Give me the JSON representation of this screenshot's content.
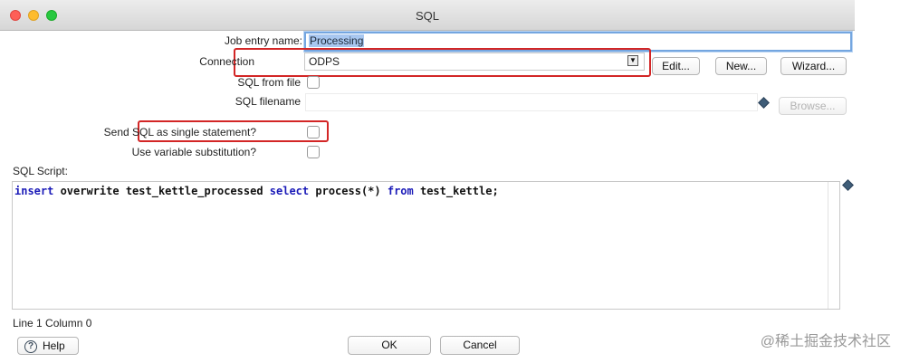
{
  "window": {
    "title": "SQL"
  },
  "form": {
    "job_entry_name_label": "Job entry name:",
    "job_entry_name_value": "Processing",
    "connection_label": "Connection",
    "connection_value": "ODPS",
    "sql_from_file_label": "SQL from file",
    "sql_filename_label": "SQL filename",
    "sql_filename_value": "",
    "send_single_label": "Send SQL as single statement?",
    "use_variable_label": "Use variable substitution?",
    "sql_script_label": "SQL Script:"
  },
  "buttons": {
    "edit": "Edit...",
    "new": "New...",
    "wizard": "Wizard...",
    "browse": "Browse...",
    "help": "Help",
    "ok": "OK",
    "cancel": "Cancel"
  },
  "editor": {
    "tokens": [
      {
        "t": "insert",
        "kw": true
      },
      {
        "t": " overwrite test_kettle_processed ",
        "kw": false
      },
      {
        "t": "select",
        "kw": true
      },
      {
        "t": " process(*) ",
        "kw": false
      },
      {
        "t": "from",
        "kw": true
      },
      {
        "t": " test_kettle;",
        "kw": false
      }
    ]
  },
  "status": {
    "line_col": "Line 1 Column 0"
  },
  "checkboxes": {
    "sql_from_file": false,
    "send_single": false,
    "use_variable": false
  },
  "watermark": "@稀土掘金技术社区",
  "colors": {
    "highlight_box": "#d32626",
    "keyword": "#1b1bb8",
    "focus": "#74a6e0"
  }
}
